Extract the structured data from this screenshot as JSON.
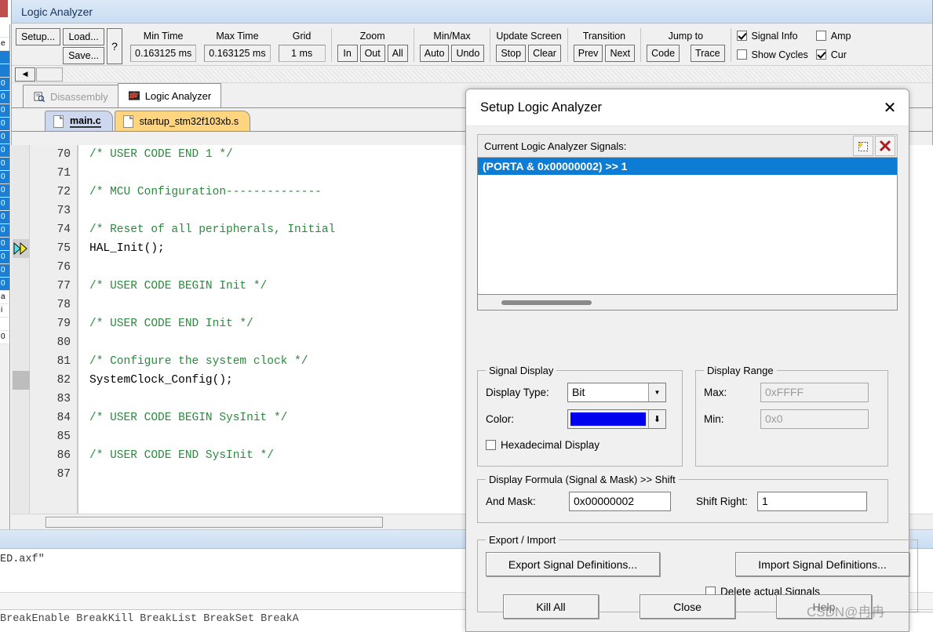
{
  "window": {
    "title": "Logic Analyzer"
  },
  "toolbar": {
    "setup_label": "Setup...",
    "load_label": "Load...",
    "save_label": "Save...",
    "help_label": "?",
    "min_time_caption": "Min Time",
    "min_time_value": "0.163125 ms",
    "max_time_caption": "Max Time",
    "max_time_value": "0.163125 ms",
    "grid_caption": "Grid",
    "grid_value": "1 ms",
    "zoom_caption": "Zoom",
    "zoom_in": "In",
    "zoom_out": "Out",
    "zoom_all": "All",
    "minmax_caption": "Min/Max",
    "minmax_auto": "Auto",
    "minmax_undo": "Undo",
    "update_caption": "Update Screen",
    "update_stop": "Stop",
    "update_clear": "Clear",
    "transition_caption": "Transition",
    "transition_prev": "Prev",
    "transition_next": "Next",
    "jumpto_caption": "Jump to",
    "jumpto_code": "Code",
    "jumpto_trace": "Trace",
    "checkboxes": [
      {
        "label": "Signal Info",
        "checked": true
      },
      {
        "label": "Amp",
        "checked": false
      },
      {
        "label": "Show Cycles",
        "checked": false
      },
      {
        "label": "Cur",
        "checked": true
      }
    ]
  },
  "view_tabs": [
    {
      "label": "Disassembly",
      "active": false,
      "icon": "disassembly-icon"
    },
    {
      "label": "Logic Analyzer",
      "active": true,
      "icon": "logic-analyzer-icon"
    }
  ],
  "file_tabs": [
    {
      "label": "main.c",
      "active": true
    },
    {
      "label": "startup_stm32f103xb.s",
      "active": false
    }
  ],
  "editor": {
    "lines": [
      {
        "num": "70",
        "text": "/* USER CODE END 1 */",
        "kind": "comment"
      },
      {
        "num": "71",
        "text": "",
        "kind": "blank"
      },
      {
        "num": "72",
        "text": "/* MCU Configuration--------------",
        "kind": "comment"
      },
      {
        "num": "73",
        "text": "",
        "kind": "blank"
      },
      {
        "num": "74",
        "text": "/* Reset of all peripherals, Initial",
        "kind": "comment"
      },
      {
        "num": "75",
        "text": "HAL_Init();",
        "kind": "code",
        "marker": "exec"
      },
      {
        "num": "76",
        "text": "",
        "kind": "blank"
      },
      {
        "num": "77",
        "text": "/* USER CODE BEGIN Init */",
        "kind": "comment"
      },
      {
        "num": "78",
        "text": "",
        "kind": "blank"
      },
      {
        "num": "79",
        "text": "/* USER CODE END Init */",
        "kind": "comment"
      },
      {
        "num": "80",
        "text": "",
        "kind": "blank"
      },
      {
        "num": "81",
        "text": "/* Configure the system clock */",
        "kind": "comment"
      },
      {
        "num": "82",
        "text": "SystemClock_Config();",
        "kind": "code",
        "marker": "highlight"
      },
      {
        "num": "83",
        "text": "",
        "kind": "blank"
      },
      {
        "num": "84",
        "text": "/* USER CODE BEGIN SysInit */",
        "kind": "comment"
      },
      {
        "num": "85",
        "text": "",
        "kind": "blank"
      },
      {
        "num": "86",
        "text": "/* USER CODE END SysInit */",
        "kind": "comment"
      },
      {
        "num": "87",
        "text": "",
        "kind": "blank"
      }
    ],
    "comment_color": "#2b8a3e"
  },
  "command_window": {
    "output_text": "ED.axf\"",
    "help_text": "BreakEnable BreakKill BreakList BreakSet BreakA"
  },
  "dialog": {
    "title": "Setup Logic Analyzer",
    "close_icon": "✕",
    "signals_group": {
      "label": "Current Logic Analyzer Signals:",
      "new_icon": "new-signal-icon",
      "delete_icon": "delete-signal-icon",
      "items": [
        {
          "text": "(PORTA & 0x00000002) >> 1",
          "selected": true
        }
      ]
    },
    "signal_display": {
      "legend": "Signal Display",
      "display_type_label": "Display Type:",
      "display_type_value": "Bit",
      "color_label": "Color:",
      "color_value": "#0000ee",
      "hex_checkbox_label": "Hexadecimal Display",
      "hex_checked": false
    },
    "display_range": {
      "legend": "Display Range",
      "max_label": "Max:",
      "max_value": "0xFFFF",
      "min_label": "Min:",
      "min_value": "0x0"
    },
    "display_formula": {
      "legend": "Display Formula (Signal & Mask) >> Shift",
      "and_mask_label": "And Mask:",
      "and_mask_value": "0x00000002",
      "shift_right_label": "Shift Right:",
      "shift_right_value": "1"
    },
    "export_import": {
      "legend": "Export / Import",
      "export_label": "Export Signal Definitions...",
      "import_label": "Import Signal Definitions...",
      "delete_checkbox_label": "Delete actual Signals",
      "delete_checked": false
    },
    "footer": {
      "kill_all": "Kill All",
      "close": "Close",
      "help": "Help"
    }
  },
  "watermark": {
    "text": "CSDN@冉冉"
  },
  "registers_sliver": {
    "cells": [
      "",
      "e",
      "",
      "",
      "0",
      "0",
      "0",
      "0",
      "0",
      "0",
      "0",
      "0",
      "0",
      "0",
      "0",
      "0",
      "0",
      "0",
      "0",
      "0",
      "a",
      "i",
      "",
      "0"
    ]
  }
}
